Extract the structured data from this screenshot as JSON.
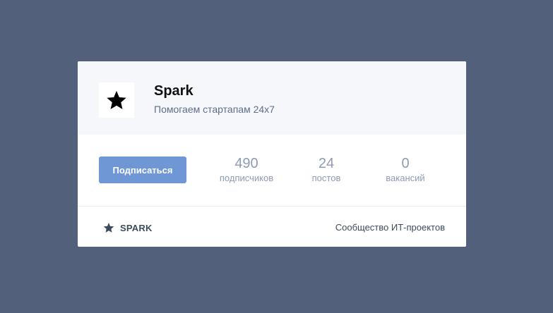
{
  "community": {
    "name": "Spark",
    "tagline": "Помогаем стартапам 24x7",
    "logo_icon": "star-icon"
  },
  "actions": {
    "subscribe_label": "Подписаться"
  },
  "stats": [
    {
      "value": "490",
      "label": "подписчиков"
    },
    {
      "value": "24",
      "label": "постов"
    },
    {
      "value": "0",
      "label": "вакансий"
    }
  ],
  "footer": {
    "brand_icon": "star-icon",
    "brand_label": "SPARK",
    "description": "Сообщество ИТ-проектов"
  },
  "colors": {
    "page_background": "#53607c",
    "header_background": "#f5f7fb",
    "button_background": "#6f97d5",
    "stat_text": "#8e9bb4",
    "subtitle_text": "#5d6f8a"
  }
}
